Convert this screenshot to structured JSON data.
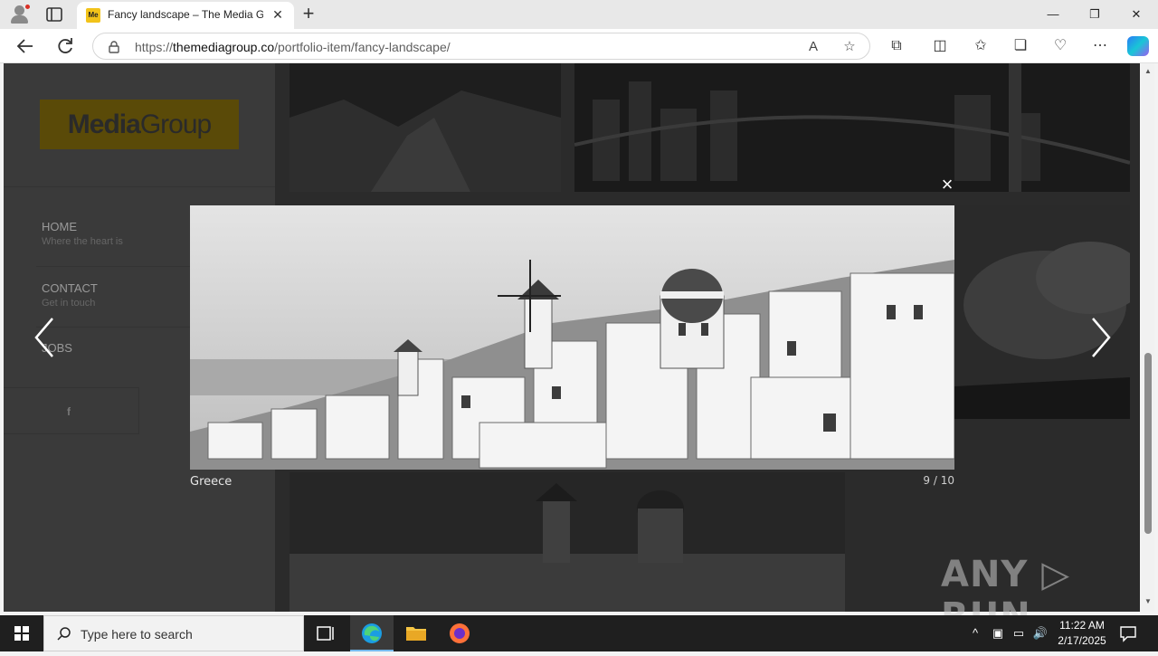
{
  "browser": {
    "tab_title": "Fancy landscape – The Media Group",
    "tab_favicon_text": "Me",
    "url_prefix": "https://",
    "url_host": "themediagroup.co",
    "url_path": "/portfolio-item/fancy-landscape/",
    "window_controls": {
      "minimize": "—",
      "restore": "❐",
      "close": "✕"
    }
  },
  "site": {
    "logo_bold": "Media",
    "logo_light": "Group",
    "menu": [
      {
        "label": "HOME",
        "sub": "Where the heart is"
      },
      {
        "label": "CONTACT",
        "sub": "Get in touch"
      },
      {
        "label": "JOBS",
        "sub": ""
      }
    ],
    "social_icon": "f"
  },
  "lightbox": {
    "close_label": "×",
    "caption": "Greece",
    "counter": "9 / 10",
    "image_subject": "Santorini village with windmills (grayscale)"
  },
  "watermark": "ANY ▷ RUN",
  "taskbar": {
    "search_placeholder": "Type here to search",
    "time": "11:22 AM",
    "date": "2/17/2025"
  },
  "colors": {
    "overlay": "#2b2b2b",
    "logo_accent": "#f2c31a",
    "taskbar": "#1f1f1f",
    "active_indicator": "#76b9ed"
  }
}
